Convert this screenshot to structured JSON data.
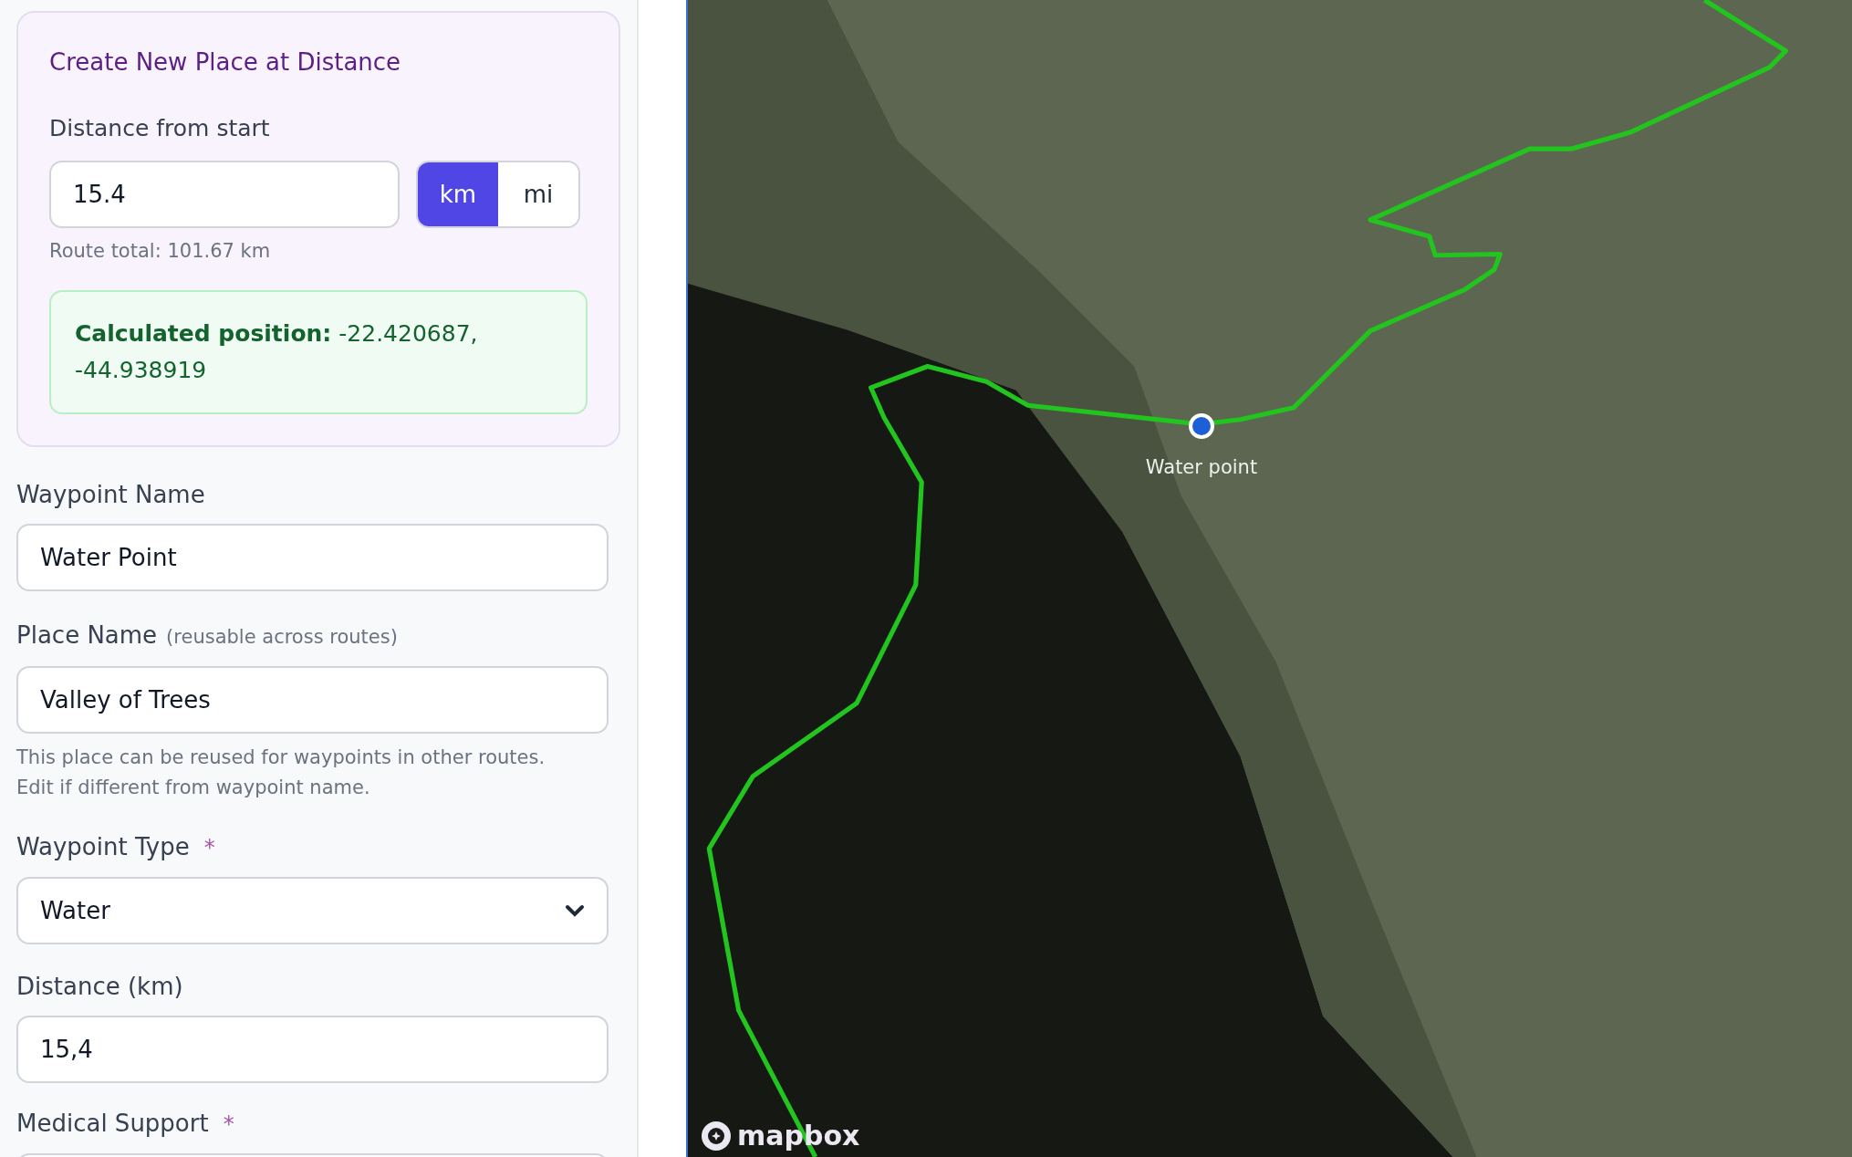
{
  "place_card": {
    "title": "Create New Place at Distance",
    "distance_label": "Distance from start",
    "distance_value": "15.4",
    "units": [
      {
        "label": "km",
        "selected": true
      },
      {
        "label": "mi",
        "selected": false
      }
    ],
    "route_total": "Route total: 101.67 km",
    "calculated_position": "**Calculated position:** -22.420687, -44.938919"
  },
  "fields": [
    {
      "kind": "input",
      "label": "Waypoint Name",
      "value": "Water Point"
    },
    {
      "kind": "input",
      "label": "Place Name",
      "hint": "(reusable across routes)",
      "value": "Valley of Trees",
      "help": "This place can be reused for waypoints in other routes. Edit if different from waypoint name."
    },
    {
      "kind": "select",
      "label": "Waypoint Type",
      "required_mark": "*",
      "value": "Water"
    },
    {
      "kind": "input",
      "label": "Distance (km)",
      "value": "15,4"
    },
    {
      "kind": "select",
      "label": "Medical Support",
      "required_mark": "*"
    }
  ],
  "map": {
    "marker_label": "Water point",
    "attribution": "mapbox"
  }
}
